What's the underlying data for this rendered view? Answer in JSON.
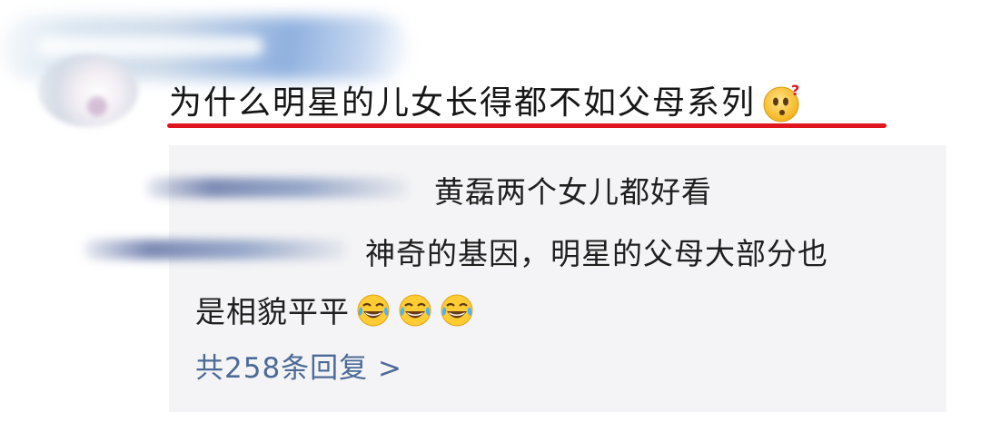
{
  "post": {
    "title": "为什么明星的儿女长得都不如父母系列",
    "title_emoji": "thinking-face-emoji"
  },
  "replies": [
    {
      "text": "黄磊两个女儿都好看"
    },
    {
      "line1": "神奇的基因，明星的父母大部分也",
      "line2": "是相貌平平"
    }
  ],
  "more_replies": "共258条回复 >",
  "colors": {
    "underline": "#e0161f",
    "link": "#4c6a98",
    "panel_bg": "#f4f4f6"
  }
}
